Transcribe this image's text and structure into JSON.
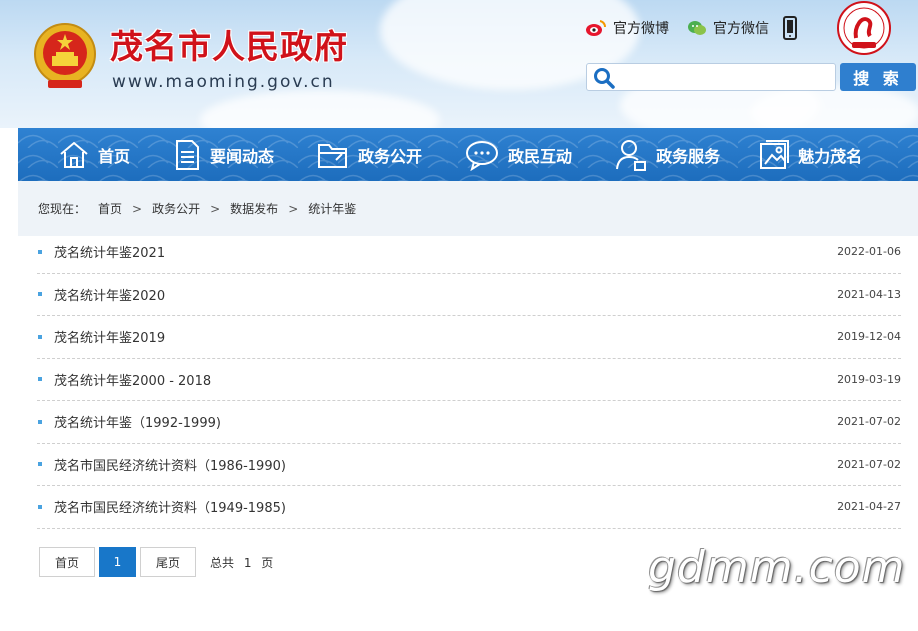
{
  "header": {
    "site_title": "茂名市人民政府",
    "site_url": "www.maoming.gov.cn",
    "links": {
      "weibo": "官方微博",
      "wechat": "官方微信"
    },
    "search": {
      "placeholder": "",
      "button_label": "搜 索"
    }
  },
  "nav": {
    "items": [
      {
        "label": "首页",
        "icon": "home-icon"
      },
      {
        "label": "要闻动态",
        "icon": "document-icon"
      },
      {
        "label": "政务公开",
        "icon": "folder-icon"
      },
      {
        "label": "政民互动",
        "icon": "chat-icon"
      },
      {
        "label": "政务服务",
        "icon": "user-service-icon"
      },
      {
        "label": "魅力茂名",
        "icon": "picture-icon"
      }
    ]
  },
  "breadcrumb": {
    "prefix": "您现在：",
    "items": [
      "首页",
      "政务公开",
      "数据发布",
      "统计年鉴"
    ]
  },
  "list": {
    "rows": [
      {
        "title": "茂名统计年鉴2021",
        "date": "2022-01-06"
      },
      {
        "title": "茂名统计年鉴2020",
        "date": "2021-04-13"
      },
      {
        "title": "茂名统计年鉴2019",
        "date": "2019-12-04"
      },
      {
        "title": "茂名统计年鉴2000 - 2018",
        "date": "2019-03-19"
      },
      {
        "title": "茂名统计年鉴（1992-1999)",
        "date": "2021-07-02"
      },
      {
        "title": "茂名市国民经济统计资料（1986-1990)",
        "date": "2021-07-02"
      },
      {
        "title": "茂名市国民经济统计资料（1949-1985)",
        "date": "2021-04-27"
      }
    ]
  },
  "pager": {
    "first_label": "首页",
    "current_page": "1",
    "last_label": "尾页",
    "total_text": "总共 1 页"
  },
  "watermark": "gdmm.com",
  "colors": {
    "title_red": "#d0121a",
    "nav_blue": "#1d6dbd",
    "search_button": "#2f7fcf",
    "pager_active": "#1877c9",
    "bullet": "#4aa3e0"
  }
}
